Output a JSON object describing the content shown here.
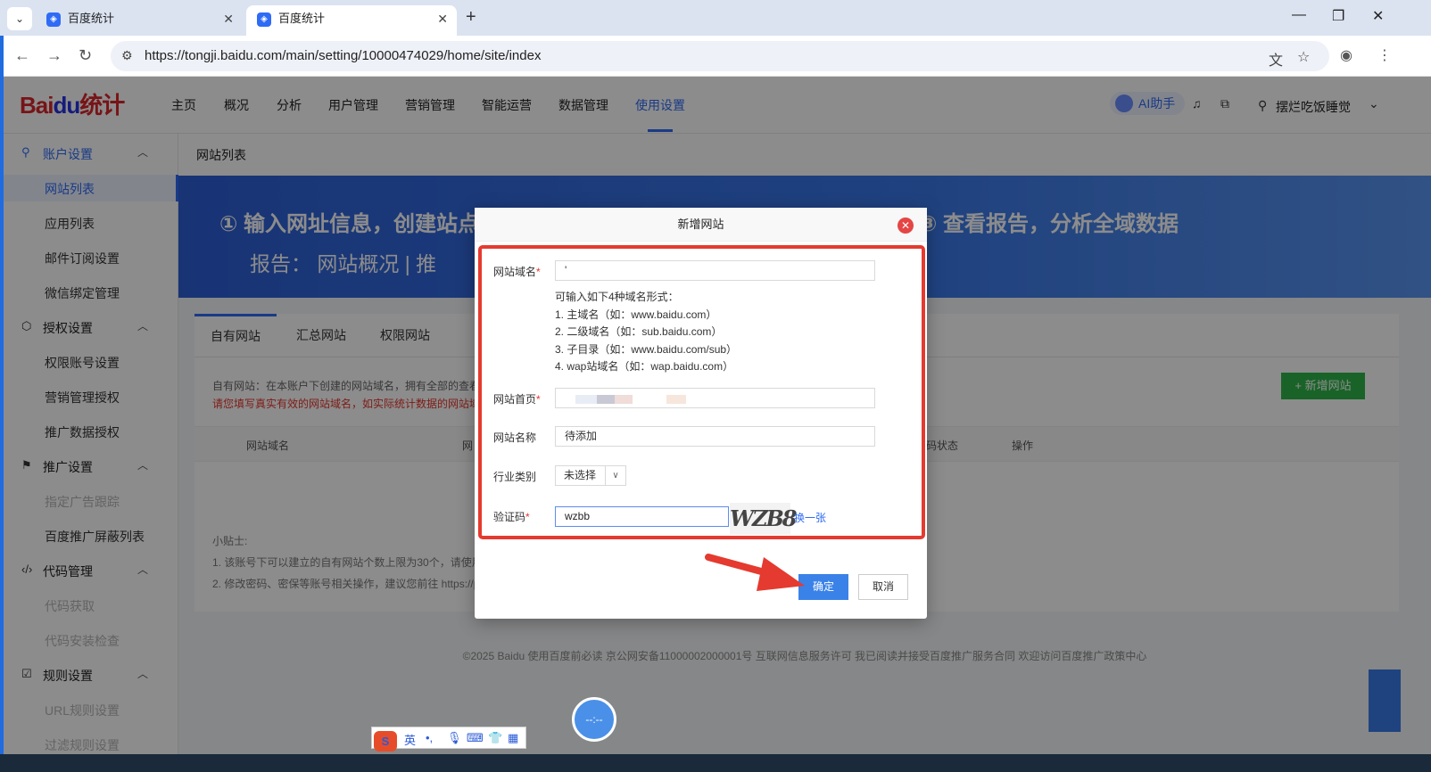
{
  "browser": {
    "tabs": [
      {
        "label": "百度统计",
        "close": "✕"
      },
      {
        "label": "百度统计",
        "close": "✕"
      }
    ],
    "new_tab": "+",
    "url": "https://tongji.baidu.com/main/setting/10000474029/home/site/index",
    "window_controls": {
      "minimize": "—",
      "restore": "❐",
      "close": "✕"
    }
  },
  "topnav": {
    "logo_a": "Bai",
    "logo_paw": "du",
    "logo_b": "统计",
    "items": [
      "主页",
      "概况",
      "分析",
      "用户管理",
      "营销管理",
      "智能运营",
      "数据管理",
      "使用设置"
    ],
    "active_item": "使用设置",
    "ai_label": "AI助手",
    "user_name": "摆烂吃饭睡觉"
  },
  "sidebar": {
    "groups": [
      {
        "label": "账户设置",
        "icon": "user-icon",
        "items": [
          {
            "label": "网站列表",
            "state": "active"
          },
          {
            "label": "应用列表"
          },
          {
            "label": "邮件订阅设置"
          },
          {
            "label": "微信绑定管理"
          }
        ]
      },
      {
        "label": "授权设置",
        "icon": "cube-icon",
        "items": [
          {
            "label": "权限账号设置"
          },
          {
            "label": "营销管理授权"
          },
          {
            "label": "推广数据授权"
          }
        ]
      },
      {
        "label": "推广设置",
        "icon": "flag-icon",
        "items": [
          {
            "label": "指定广告跟踪",
            "state": "disabled"
          },
          {
            "label": "百度推广屏蔽列表"
          }
        ]
      },
      {
        "label": "代码管理",
        "icon": "code-icon",
        "items": [
          {
            "label": "代码获取",
            "state": "disabled"
          },
          {
            "label": "代码安装检查",
            "state": "disabled"
          }
        ]
      },
      {
        "label": "规则设置",
        "icon": "rules-icon",
        "items": [
          {
            "label": "URL规则设置",
            "state": "disabled"
          },
          {
            "label": "过滤规则设置",
            "state": "disabled"
          }
        ]
      }
    ]
  },
  "content": {
    "header": "网站列表",
    "banner": {
      "step1": "① 输入网址信息，创建站点",
      "report": "报告：  网站概况    |    推",
      "step3": "③ 查看报告，分析全域数据"
    },
    "tabs": [
      "自有网站",
      "汇总网站",
      "权限网站"
    ],
    "desc": "自有网站：在本账户下创建的网站域名，拥有全部的查看",
    "desc_red": "请您填写真实有效的网站域名，如实际统计数据的网站域",
    "add_button": "+ 新增网站",
    "table_headers": {
      "domain": "网站域名",
      "homepage": "网",
      "status": "码状态",
      "action": "操作"
    },
    "tips_title": "小贴士:",
    "tip1": "1. 该账号下可以建立的自有网站个数上限为30个，请使用",
    "tip2": "2. 修改密码、密保等账号相关操作，建议您前往 https://p"
  },
  "footer": "©2025 Baidu 使用百度前必读 京公网安备11000002000001号 互联网信息服务许可 我已阅读并接受百度推广服务合同 欢迎访问百度推广政策中心",
  "dialog": {
    "title": "新增网站",
    "fields": {
      "domain_label": "网站域名",
      "domain_value": "'",
      "domain_hint_title": "可输入如下4种域名形式：",
      "domain_hints": [
        "1. 主域名（如：www.baidu.com）",
        "2. 二级域名（如：sub.baidu.com）",
        "3. 子目录（如：www.baidu.com/sub）",
        "4. wap站域名（如：wap.baidu.com）"
      ],
      "homepage_label": "网站首页",
      "name_label": "网站名称",
      "name_value": "待添加",
      "industry_label": "行业类别",
      "industry_value": "未选择",
      "captcha_label": "验证码",
      "captcha_value": "wzbb",
      "captcha_image_text": "WZB8",
      "refresh": "换一张",
      "required_mark": "*"
    },
    "ok": "确定",
    "cancel": "取消"
  },
  "ime": {
    "lang": "英",
    "punct": "•,"
  },
  "float_circle": "--:--",
  "colors": {
    "accent": "#2f6bf5",
    "highlight_box": "#e53a2f",
    "add_button": "#2eb54a"
  }
}
